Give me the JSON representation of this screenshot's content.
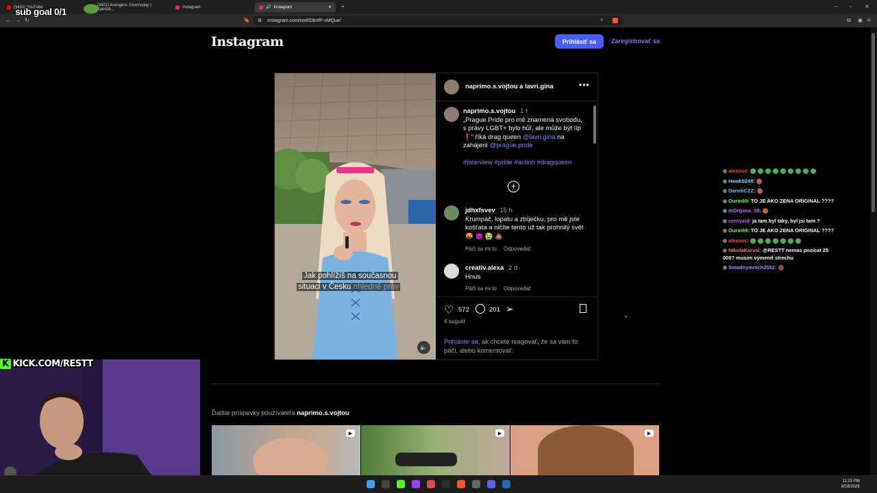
{
  "browser": {
    "tabs": [
      {
        "title": "(3401) YouTube",
        "active": false
      },
      {
        "title": "(3401) Avengers: Doomsday | Special...",
        "active": false
      },
      {
        "title": "Instagram",
        "active": false
      },
      {
        "title": "Instagram",
        "active": true
      }
    ],
    "url": "instagram.com/reel/DbnfP-xMQue/"
  },
  "instagram": {
    "logo": "Instagram",
    "login_button": "Prihlásiť sa",
    "signup_link": "Zaregistrovať sa",
    "post": {
      "header_author": "naprimo.s.vojtou a lavri.gina",
      "video_caption_line1": "Jak pohlížíš na současnou",
      "video_caption_line2": "situaci v Česku",
      "video_caption_faded": "ohledně práv",
      "caption": {
        "username": "naprimo.s.vojtou",
        "time": "1 t",
        "text": "„Prague Pride pro mě znamená svobodu, s právy LGBT+ bylo hůř, ale může být líp ❗️“ říká drag queen",
        "mention1": "@lavri.gina",
        "middle": " na zahájení ",
        "mention2": "@prague.pride",
        "hashtags": "#interview #pride #action #dragqueen"
      },
      "comments": [
        {
          "username": "jdhxfsvev",
          "time": "15 h",
          "text": "Krumpáč, lopatu a zbíječku, pro mě jste košťata a ničíte tento už tak prohnilý svět 🤬 👿 😭 💩",
          "like_label": "Páči sa mi to",
          "reply_label": "Odpovedať"
        },
        {
          "username": "creativ.alexa",
          "time": "2 d",
          "text": "Hnus",
          "like_label": "Páči sa mi to",
          "reply_label": "Odpovedať"
        }
      ],
      "likes": "572",
      "comment_count": "201",
      "date": "4 august",
      "login_prompt_link": "Prihláste sa",
      "login_prompt_rest": ", ak chcete reagovať, že sa vám to páči, alebo komentovať."
    },
    "more_posts_prefix": "Ďalšie príspevky používateľa",
    "more_posts_user": "naprimo.s.vojtou"
  },
  "overlay": {
    "sub_goal": "sub goal 0/1",
    "kick_k": "K",
    "kick_url": "KICK.COM/RESTT"
  },
  "chat": [
    {
      "user": "alexosc:",
      "color": "#ff4b4b",
      "msg": ""
    },
    {
      "user": "Hawk9248:",
      "color": "#7fd0ff",
      "msg": ""
    },
    {
      "user": "DanekCZZ:",
      "color": "#4fc8ff",
      "msg": ""
    },
    {
      "user": "Ourin69:",
      "color": "#5bff6a",
      "msg": "TO JE AKO ZENA ORIGINAL ????"
    },
    {
      "user": "mOrgana_08:",
      "color": "#b469ff",
      "msg": ""
    },
    {
      "user": "cernyzid:",
      "color": "#d05cff",
      "msg": "ja tam byl taky, byl jsi tam ?"
    },
    {
      "user": "Ourin69:",
      "color": "#5bff6a",
      "msg": "TO JE AKO ZENA ORIGINAL ????"
    },
    {
      "user": "alexosc:",
      "color": "#ff4b4b",
      "msg": ""
    },
    {
      "user": "NikolaKarval:",
      "color": "#ff6b6b",
      "msg": "@RESTT nemas pozicat 25 000? musim vymenit strechu"
    },
    {
      "user": "Smadnymnich2552:",
      "color": "#8aa0ff",
      "msg": ""
    }
  ],
  "taskbar": {
    "time": "11:23 PM",
    "date": "8/18/2026"
  },
  "colors": {
    "accent": "#4a5df9",
    "link": "#7d8cff"
  }
}
